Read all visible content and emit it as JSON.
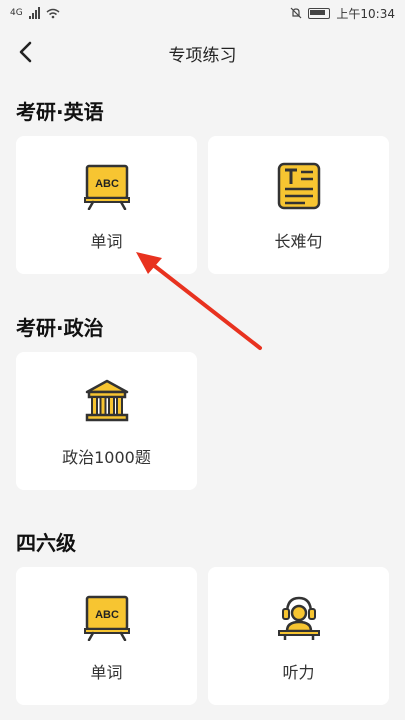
{
  "status_bar": {
    "network_label": "4G",
    "time": "上午10:34"
  },
  "nav": {
    "title": "专项练习"
  },
  "sections": [
    {
      "title": "考研·英语",
      "cards": [
        {
          "label": "单词",
          "icon": "abc-board-icon"
        },
        {
          "label": "长难句",
          "icon": "text-document-icon"
        }
      ]
    },
    {
      "title": "考研·政治",
      "cards": [
        {
          "label": "政治1000题",
          "icon": "government-building-icon"
        }
      ]
    },
    {
      "title": "四六级",
      "cards": [
        {
          "label": "单词",
          "icon": "abc-board-icon"
        },
        {
          "label": "听力",
          "icon": "listening-headset-icon"
        }
      ]
    }
  ],
  "colors": {
    "accent_yellow": "#f7c531",
    "icon_outline": "#333333",
    "annotation_arrow": "#e8321f"
  }
}
